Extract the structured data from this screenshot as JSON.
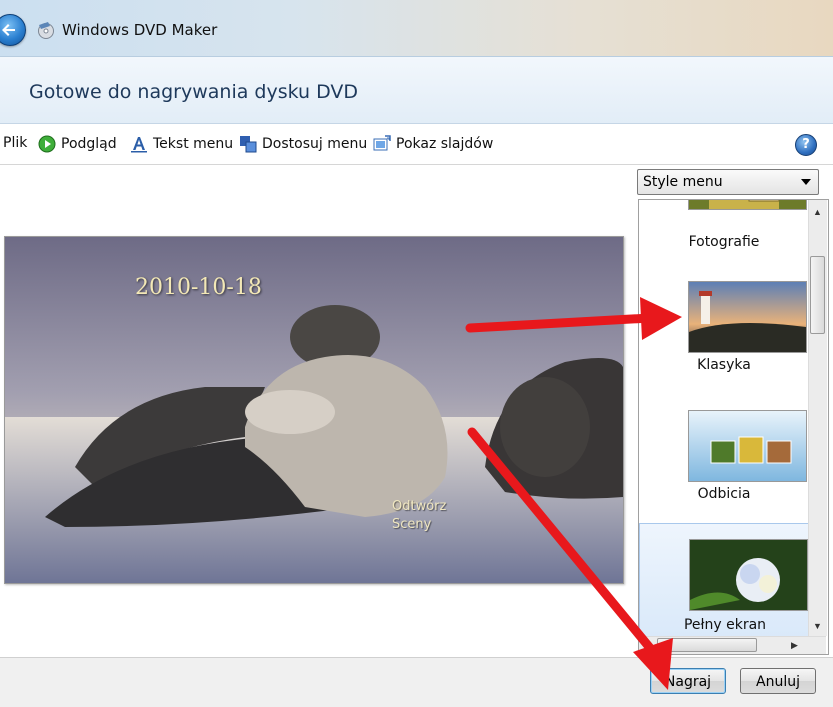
{
  "window": {
    "title": "Windows DVD Maker"
  },
  "header": {
    "title": "Gotowe do nagrywania dysku DVD"
  },
  "toolbar": {
    "items": [
      {
        "label": "Plik",
        "icon": "file-icon"
      },
      {
        "label": "Podgląd",
        "icon": "play-icon"
      },
      {
        "label": "Tekst menu",
        "icon": "text-icon"
      },
      {
        "label": "Dostosuj menu",
        "icon": "customize-icon"
      },
      {
        "label": "Pokaz slajdów",
        "icon": "slideshow-icon"
      }
    ],
    "help": "?"
  },
  "preview": {
    "date_text": "2010-10-18",
    "link_play": "Odtwórz",
    "link_scenes": "Sceny"
  },
  "style_menu": {
    "selected": "Style menu",
    "items": [
      {
        "label": "Fotografie",
        "selected": false
      },
      {
        "label": "Klasyka",
        "selected": false
      },
      {
        "label": "Odbicia",
        "selected": false
      },
      {
        "label": "Pełny ekran",
        "selected": true
      }
    ]
  },
  "buttons": {
    "burn": "Nagraj",
    "cancel": "Anuluj"
  },
  "annotation": {
    "arrow_color": "#e8181c"
  }
}
